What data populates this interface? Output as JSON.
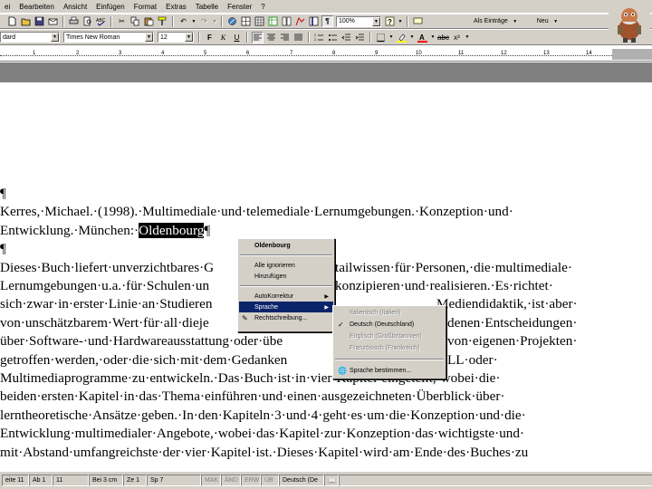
{
  "menu": [
    "ei",
    "Bearbeiten",
    "Ansicht",
    "Einfügen",
    "Format",
    "Extras",
    "Tabelle",
    "Fenster",
    "?"
  ],
  "toolbar": {
    "zoom": "100%",
    "entries_button": "Als Einträge",
    "new_button": "Neu"
  },
  "format": {
    "style": "dard",
    "font": "Times New Roman",
    "size": "12"
  },
  "ruler": {
    "numbers": [
      "1",
      "2",
      "3",
      "4",
      "5",
      "6",
      "7",
      "8",
      "9",
      "10",
      "11",
      "12",
      "13",
      "14",
      "15"
    ]
  },
  "document": {
    "lines": [
      "¶",
      "Kerres,·Michael.·(1998).·Multimediale·und·telemediale·Lernumgebungen.·Konzeption·und·",
      "Entwicklung.·München:·",
      "¶",
      "Dieses·Buch·liefert·unverzichtbares·G",
      "Lernumgebungen·u.a.·für·Schulen·un",
      "sich·zwar·in·erster·Linie·an·Studieren",
      "von·unschätzbarem·Wert·für·all·dieje",
      "über·Software-·und·Hardwareausstattung·oder·übe",
      "getroffen·werden,·oder·die·sich·mit·dem·Gedanken",
      "Multimediaprogramme·zu·entwickeln.·Das·Buch·ist·in·vier·Kapitel·eingeteilt,·wobei·die·",
      "beiden·ersten·Kapitel·in·das·Thema·einführen·und·einen·ausgezeichneten·Überblick·über·",
      "lerntheoretische·Ansätze·geben.·In·den·Kapiteln·3·und·4·geht·es·um·die·Konzeption·und·die·",
      "Entwicklung·multimedialer·Angebote,·wobei·das·Kapitel·zur·Konzeption·das·wichtigste·und·",
      "mit·Abstand·umfangreichste·der·vier·Kapitel·ist.·Dieses·Kapitel·wird·am·Ende·des·Buches·zu"
    ],
    "selected_word": "Oldenbourg",
    "pilcrow": "¶",
    "right_fragments": {
      "line4": "tailwissen·für·Personen,·die·multimediale·",
      "line5": "konzipieren·und·realisieren.·Es·richtet·",
      "line6": "Mediendidaktik,·ist·aber·",
      "line7": "denen·Entscheidungen·",
      "line8": "von·eigenen·Projekten·",
      "line9": "LL·oder·"
    }
  },
  "context_menu": {
    "title": "Oldenbourg",
    "items": [
      "Alle ignorieren",
      "Hinzufügen",
      "AutoKorrektur",
      "Sprache",
      "Rechtschreibung..."
    ]
  },
  "language_submenu": {
    "items": [
      "Italienisch (Italien)",
      "Deutsch (Deutschland)",
      "Englisch (Großbritannien)",
      "Französisch (Frankreich)",
      "Sprache bestimmen..."
    ]
  },
  "statusbar": {
    "cells": [
      "eite 11",
      "Ab 1",
      "11",
      "Bei 3 cm",
      "Ze 1",
      "Sp 7",
      "MAK",
      "ÄND",
      "ERW",
      "ÜB",
      "Deutsch (De"
    ]
  }
}
